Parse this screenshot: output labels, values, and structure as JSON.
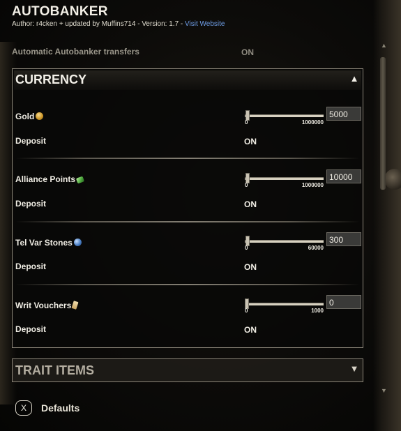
{
  "header": {
    "title": "AUTOBANKER",
    "meta_prefix": "Author: r4cken + updated by Muffins714 - Version: 1.7 - ",
    "visit_link": "Visit Website"
  },
  "auto_transfers": {
    "label": "Automatic Autobanker transfers",
    "value": "ON"
  },
  "currency_section": {
    "title": "CURRENCY",
    "toggle_icon": "collapse-up-arrow",
    "items": [
      {
        "label": "Gold",
        "icon": "gold-coin-icon",
        "value": "5000",
        "min": "0",
        "max": "1000000",
        "fraction": 0.005,
        "deposit_label": "Deposit",
        "deposit_value": "ON"
      },
      {
        "label": "Alliance Points",
        "icon": "alliance-points-icon",
        "value": "10000",
        "min": "0",
        "max": "1000000",
        "fraction": 0.01,
        "deposit_label": "Deposit",
        "deposit_value": "ON"
      },
      {
        "label": "Tel Var Stones",
        "icon": "tel-var-stone-icon",
        "value": "300",
        "min": "0",
        "max": "60000",
        "fraction": 0.005,
        "deposit_label": "Deposit",
        "deposit_value": "ON"
      },
      {
        "label": "Writ Vouchers",
        "icon": "writ-voucher-icon",
        "value": "0",
        "min": "0",
        "max": "1000",
        "fraction": 0.0,
        "deposit_label": "Deposit",
        "deposit_value": "ON"
      }
    ]
  },
  "trait_section": {
    "title": "TRAIT ITEMS",
    "toggle_icon": "expand-down-arrow"
  },
  "footer": {
    "key": "X",
    "defaults_label": "Defaults"
  }
}
